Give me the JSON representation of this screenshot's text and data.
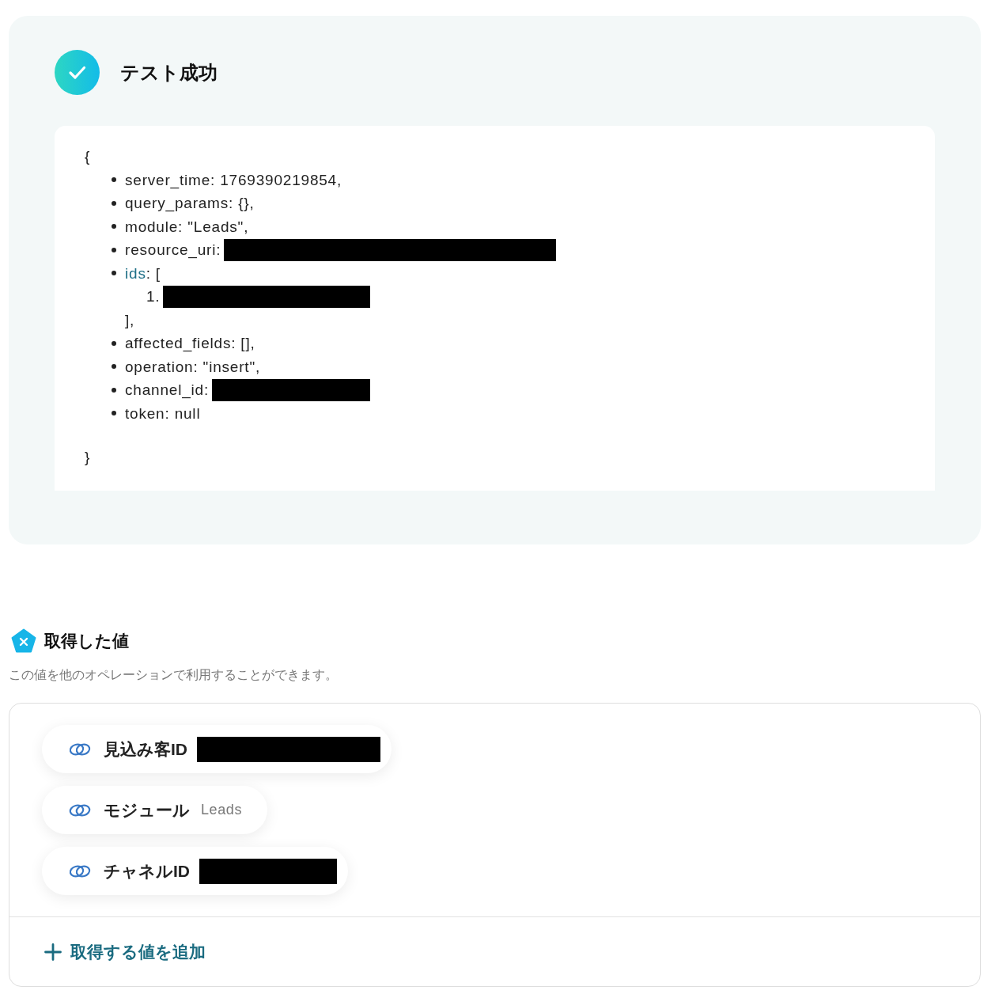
{
  "test_panel": {
    "title": "テスト成功",
    "response": {
      "open": "{",
      "close": "}",
      "entries": [
        {
          "kind": "text",
          "text": "server_time: 1769390219854,"
        },
        {
          "kind": "text",
          "text": "query_params: {},"
        },
        {
          "kind": "text",
          "text": "module: \"Leads\","
        },
        {
          "kind": "redacted",
          "text": "resource_uri:"
        },
        {
          "kind": "array",
          "key": "ids",
          "text": ": [",
          "items": [
            {
              "label": "1.",
              "kind": "redacted"
            }
          ],
          "close": "],"
        },
        {
          "kind": "text",
          "text": "affected_fields: [],"
        },
        {
          "kind": "text",
          "text": "operation: \"insert\","
        },
        {
          "kind": "redacted",
          "text": "channel_id:"
        },
        {
          "kind": "text",
          "text": "token: null"
        }
      ]
    }
  },
  "retrieved_values": {
    "title": "取得した値",
    "description": "この値を他のオペレーションで利用することができます。",
    "items": [
      {
        "label": "見込み客ID",
        "kind": "redacted"
      },
      {
        "label": "モジュール",
        "kind": "text",
        "value": "Leads"
      },
      {
        "label": "チャネルID",
        "kind": "redacted"
      }
    ],
    "add_button": "取得する値を追加"
  }
}
